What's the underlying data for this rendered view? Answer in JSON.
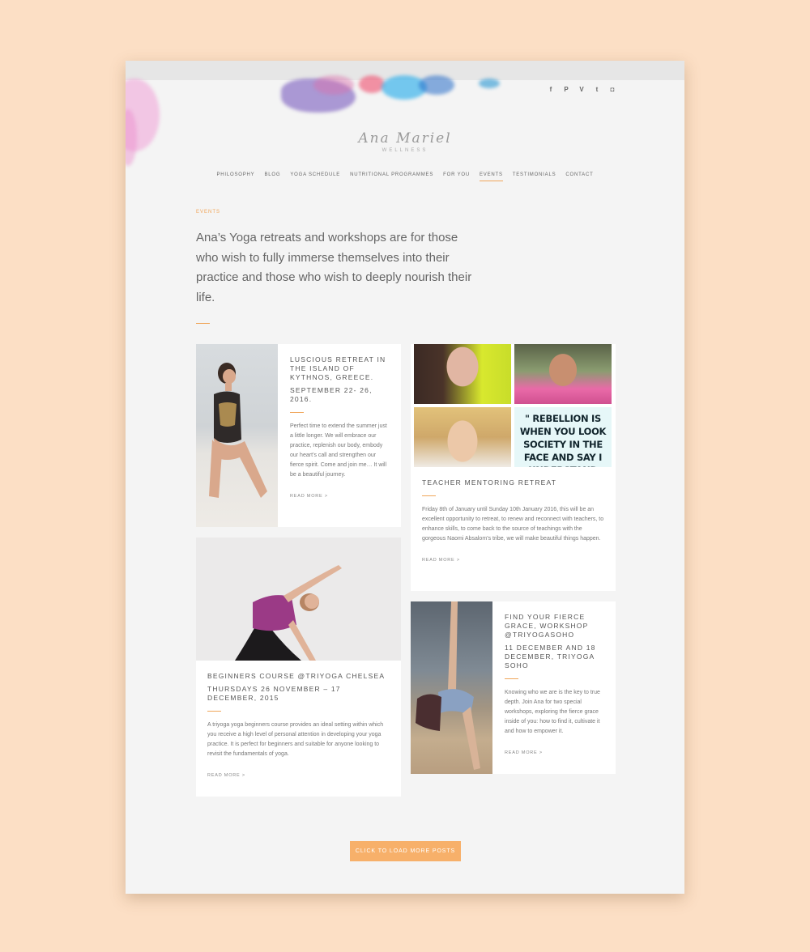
{
  "social_icons": [
    "facebook-icon",
    "pinterest-icon",
    "vimeo-icon",
    "twitter-icon",
    "instagram-icon"
  ],
  "social_glyphs": [
    "f",
    "P",
    "V",
    "t",
    "◘"
  ],
  "logo": {
    "script": "Ana Mariel",
    "subtitle": "WELLNESS"
  },
  "nav": [
    {
      "label": "PHILOSOPHY",
      "key": "philosophy"
    },
    {
      "label": "BLOG",
      "key": "blog"
    },
    {
      "label": "YOGA SCHEDULE",
      "key": "yoga-schedule"
    },
    {
      "label": "NUTRITIONAL PROGRAMMES",
      "key": "nutritional-programmes"
    },
    {
      "label": "FOR YOU",
      "key": "for-you"
    },
    {
      "label": "EVENTS",
      "key": "events",
      "active": true
    },
    {
      "label": "TESTIMONIALS",
      "key": "testimonials"
    },
    {
      "label": "CONTACT",
      "key": "contact"
    }
  ],
  "page": {
    "kicker": "EVENTS",
    "intro": "Ana’s Yoga retreats and workshops are for those who wish to fully immerse themselves into their practice and those who wish to deeply nourish their life."
  },
  "cards": {
    "kythnos": {
      "title": "LUSCIOUS RETREAT IN THE ISLAND OF KYTHNOS, GREECE.",
      "date": "SEPTEMBER 22- 26, 2016.",
      "body": "Perfect time to extend the summer just a little longer. We will embrace our practice, replenish our body, embody our heart’s call and strengthen our fierce spirit. Come and join me… It will be a beautiful journey.",
      "more": "READ MORE >"
    },
    "beginners": {
      "title": "BEGINNERS COURSE @TRIYOGA CHELSEA",
      "date": "THURSDAYS 26 NOVEMBER – 17 DECEMBER, 2015",
      "body": "A triyoga yoga beginners course provides an ideal setting within which you receive a high level of personal attention in developing your yoga practice. It is perfect for beginners and suitable for anyone looking to revisit the fundamentals of yoga.",
      "more": "READ MORE >"
    },
    "mentoring": {
      "title": "TEACHER MENTORING RETREAT",
      "quote": "\" REBELLION IS WHEN YOU LOOK SOCIETY IN THE FACE AND SAY I UNDERSTAND WHO YOU WANT ME TO BE, BUT I'M",
      "body": "Friday 8th of January until Sunday 10th January 2016, this will be an excellent opportunity to retreat, to renew and reconnect with teachers, to enhance skills, to come back to the source of teachings with the gorgeous Naomi Absalom’s tribe, we will make beautiful things happen.",
      "more": "READ MORE >"
    },
    "fierce": {
      "title": "FIND YOUR FIERCE GRACE, WORKSHOP @TRIYOGASOHO",
      "date": "11 DECEMBER AND 18 DECEMBER, TRIYOGA SOHO",
      "body": "Knowing who we are is the key to true depth. Join Ana for two special workshops, exploring the fierce grace inside of you: how to find it, cultivate it and how to empower it.",
      "more": "READ MORE >"
    }
  },
  "load_more": "CLICK TO LOAD MORE POSTS",
  "colors": {
    "accent": "#f0a65a",
    "button": "#f7b06a",
    "background": "#fcdfc5"
  }
}
